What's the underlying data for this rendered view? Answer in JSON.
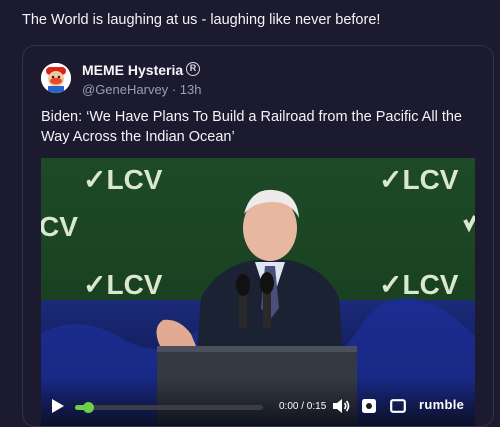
{
  "post": {
    "text": "The World is laughing at us - laughing like never before!"
  },
  "embed": {
    "author_name": "MEME Hysteria",
    "verified_mark": "R",
    "handle": "@GeneHarvey",
    "separator": "·",
    "time": "13h",
    "text": "Biden: ‘We Have Plans To Build a Railroad from the Pacific All the Way Across the Indian Ocean’",
    "video": {
      "banner_text": "✓LCV",
      "banner_partial": "CV",
      "progress_fraction": 0.07,
      "time_readout": "0:00 / 0:15",
      "brand": "rumble",
      "accent_color": "#6fcf4a"
    }
  },
  "icons": [
    "play-icon",
    "volume-icon",
    "settings-icon",
    "theater-icon",
    "verified-icon"
  ]
}
